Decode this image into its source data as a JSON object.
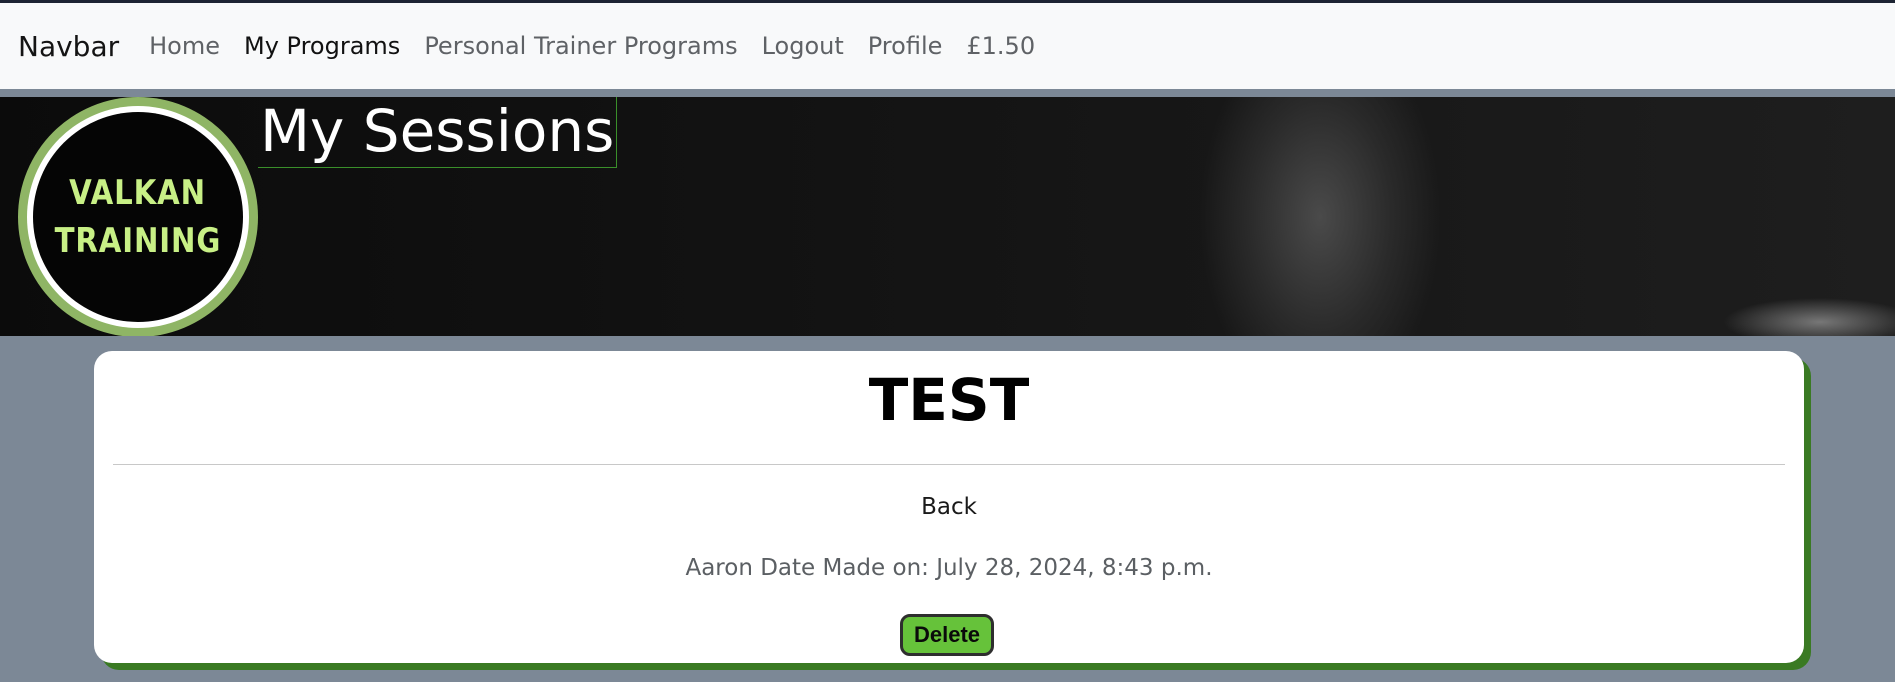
{
  "navbar": {
    "brand": "Navbar",
    "links": [
      {
        "label": "Home"
      },
      {
        "label": "My Programs"
      },
      {
        "label": "Personal Trainer Programs"
      },
      {
        "label": "Logout"
      },
      {
        "label": "Profile"
      },
      {
        "label": "£1.50"
      }
    ]
  },
  "hero": {
    "title": "My Sessions",
    "logo_line1": "VALKAN",
    "logo_line2": "TRAINING"
  },
  "session": {
    "title": "TEST",
    "back_label": "Back",
    "meta": "Aaron Date Made on: July 28, 2024, 8:43 p.m.",
    "delete_label": "Delete"
  },
  "colors": {
    "accent_green": "#66c23a",
    "card_shadow": "#3a7a23",
    "page_background": "#7c8896"
  }
}
